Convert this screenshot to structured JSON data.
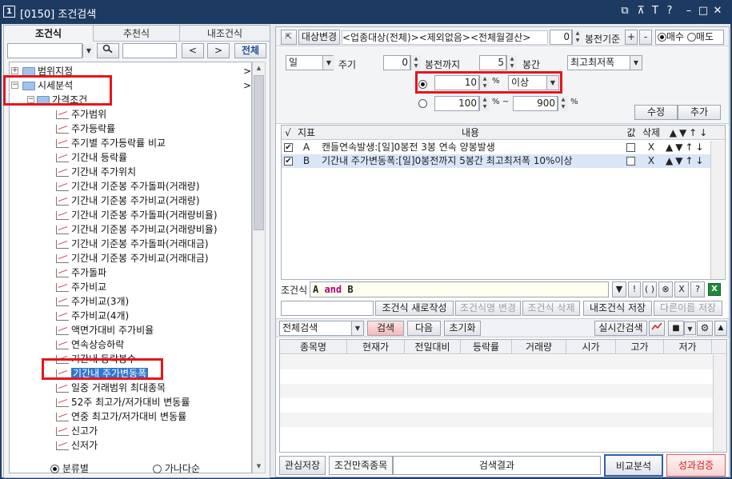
{
  "window": {
    "badge": "1",
    "title": "[0150] 조건검색",
    "icons": [
      "restore-icon",
      "pin-icon",
      "font-icon",
      "help-icon",
      "minimize-icon",
      "maximize-icon",
      "close-icon"
    ],
    "glyphs": [
      "⧉",
      "⊼",
      "T",
      "?",
      "–",
      "□",
      "✕"
    ]
  },
  "left": {
    "tabs": [
      "조건식",
      "추천식",
      "내조건식"
    ],
    "search_placeholder": "",
    "prev_label": "<",
    "next_label": ">",
    "all_label": "전체",
    "tree": [
      {
        "label": "범위지정",
        "type": "folder",
        "expander": "+",
        "arrow": ">"
      },
      {
        "label": "시세분석",
        "type": "folder",
        "expander": "−",
        "arrow": ">"
      },
      {
        "label": "가격조건",
        "type": "folder",
        "expander": "−"
      },
      {
        "label": "주가범위",
        "type": "item"
      },
      {
        "label": "주가등락률",
        "type": "item"
      },
      {
        "label": "주기별 주가등락률 비교",
        "type": "item"
      },
      {
        "label": "기간내 등락률",
        "type": "item"
      },
      {
        "label": "기간내 주가위치",
        "type": "item"
      },
      {
        "label": "기간내 기준봉 주가돌파(거래량)",
        "type": "item"
      },
      {
        "label": "기간내 기준봉 주가비교(거래량)",
        "type": "item"
      },
      {
        "label": "기간내 기준봉 주가돌파(거래량비율)",
        "type": "item"
      },
      {
        "label": "기간내 기준봉 주가비교(거래량비율)",
        "type": "item"
      },
      {
        "label": "기간내 기준봉 주가돌파(거래대금)",
        "type": "item"
      },
      {
        "label": "기간내 기준봉 주가비교(거래대금)",
        "type": "item"
      },
      {
        "label": "주가돌파",
        "type": "item"
      },
      {
        "label": "주가비교",
        "type": "item"
      },
      {
        "label": "주가비교(3개)",
        "type": "item"
      },
      {
        "label": "주가비교(4개)",
        "type": "item"
      },
      {
        "label": "액면가대비 주가비율",
        "type": "item"
      },
      {
        "label": "연속상승하락",
        "type": "item"
      },
      {
        "label": "기간내 등락봉수",
        "type": "item"
      },
      {
        "label": "기간내 주가변동폭",
        "type": "item",
        "selected": true
      },
      {
        "label": "일중 거래범위 최대종목",
        "type": "item"
      },
      {
        "label": "52주 최고가/저가대비 변동률",
        "type": "item"
      },
      {
        "label": "연중 최고가/저가대비 변동률",
        "type": "item"
      },
      {
        "label": "신고가",
        "type": "item"
      },
      {
        "label": "신저가",
        "type": "item"
      }
    ],
    "sort_by_category": "분류별",
    "sort_by_name": "가나다순"
  },
  "right": {
    "toolbar": {
      "target_change": "대상변경",
      "target_text": "<업종대상(전체)><제외없음><전체월결산>",
      "bar_value": "0",
      "bar_basis": "봉전기준",
      "plus": "+",
      "minus": "-",
      "buy": "매수",
      "sell": "매도"
    },
    "params": {
      "period": "일",
      "period_label": "주기",
      "from_bar": "0",
      "from_label": "봉전까지",
      "bars": "5",
      "bars_label": "봉간",
      "metric": "최고최저폭",
      "value1": "10",
      "unit": "%",
      "op": "이상",
      "range_from": "100",
      "range_to": "900",
      "tilde": "~",
      "modify": "수정",
      "add": "추가"
    },
    "grid": {
      "headers": [
        "√",
        "지표",
        "내용",
        "값",
        "삭제"
      ],
      "rows": [
        {
          "checked": true,
          "key": "A",
          "content": "캔들연속발생:[일]0봉전 3봉 연속 양봉발생",
          "del": "X"
        },
        {
          "checked": true,
          "key": "B",
          "content": "기간내 주가변동폭:[일]0봉전까지 5봉간 최고최저폭 10%이상",
          "del": "X"
        }
      ],
      "move_arrows": [
        "▲",
        "▼",
        "↑",
        "↓"
      ]
    },
    "formula": {
      "label": "조건식",
      "expr_a": "A",
      "expr_op": "and",
      "expr_b": "B",
      "buttons": [
        "▼",
        "!",
        "( )",
        "⊗",
        "X",
        "?"
      ]
    },
    "actions": {
      "new_write": "조건식 새로작성",
      "rename": "조건식명 변경",
      "delete": "조건식 삭제",
      "save_mine": "내조건식 저장",
      "save_as": "다른이름 저장"
    },
    "search": {
      "scope": "전체검색",
      "search": "검색",
      "next": "다음",
      "reset": "초기화",
      "realtime": "실시간검색"
    },
    "result_headers": [
      "종목명",
      "현재가",
      "전일대비",
      "등락률",
      "거래량",
      "시가",
      "고가",
      "저가"
    ],
    "footer": {
      "watch_save": "관심저장",
      "matched": "조건만족종목",
      "count": "",
      "results": "검색결과",
      "compare": "비교분석",
      "verify": "성과검증"
    }
  },
  "colors": {
    "titlebar": "#1d3b62",
    "highlight_box": "#e8141c",
    "selection": "#3078d0",
    "verify": "#e03a3a",
    "compare_border": "#2f5fb0"
  }
}
